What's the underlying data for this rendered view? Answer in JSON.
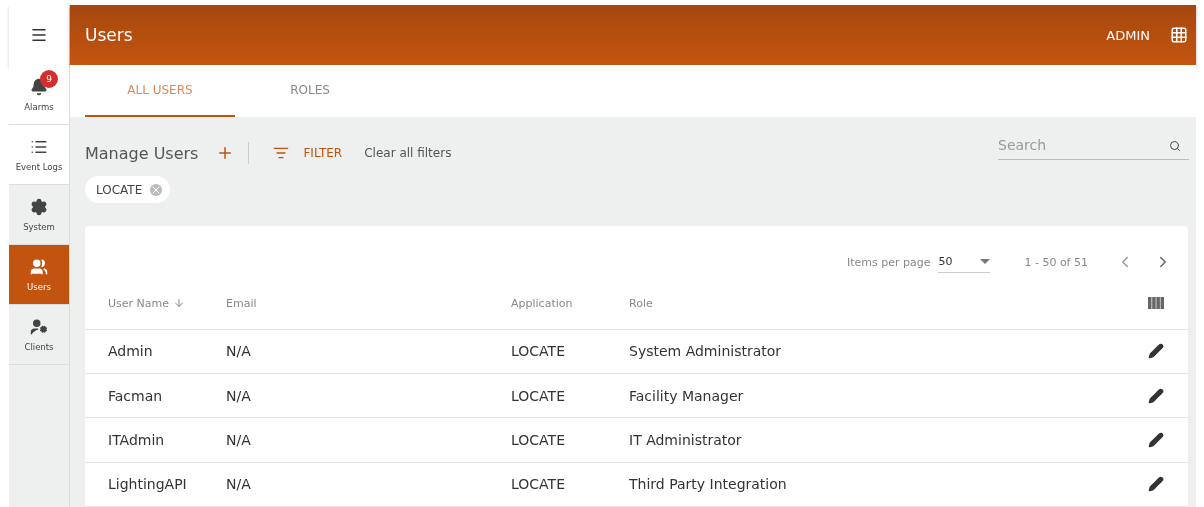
{
  "header": {
    "title": "Users",
    "user": "ADMIN"
  },
  "sidebar": {
    "items": [
      {
        "label": "Alarms",
        "badge": "9",
        "selected": false,
        "shaded": false
      },
      {
        "label": "Event Logs",
        "selected": false,
        "shaded": false
      },
      {
        "label": "System",
        "selected": false,
        "shaded": true
      },
      {
        "label": "Users",
        "selected": true,
        "shaded": false
      },
      {
        "label": "Clients",
        "selected": false,
        "shaded": true
      }
    ]
  },
  "tabs": [
    {
      "label": "ALL USERS",
      "selected": true
    },
    {
      "label": "ROLES",
      "selected": false
    }
  ],
  "toolbar": {
    "title": "Manage Users",
    "filter": "FILTER",
    "clear": "Clear all filters",
    "search": {
      "placeholder": "Search"
    }
  },
  "chips": [
    "LOCATE"
  ],
  "table": {
    "pagination": {
      "label": "Items per page",
      "page_size": "50",
      "range": "1 - 50 of 51"
    },
    "columns": [
      "User Name",
      "Email",
      "Application",
      "Role"
    ],
    "rows": [
      [
        "Admin",
        "N/A",
        "LOCATE",
        "System Administrator"
      ],
      [
        "Facman",
        "N/A",
        "LOCATE",
        "Facility Manager"
      ],
      [
        "ITAdmin",
        "N/A",
        "LOCATE",
        "IT Administrator"
      ],
      [
        "LightingAPI",
        "N/A",
        "LOCATE",
        "Third Party Integration"
      ]
    ]
  }
}
